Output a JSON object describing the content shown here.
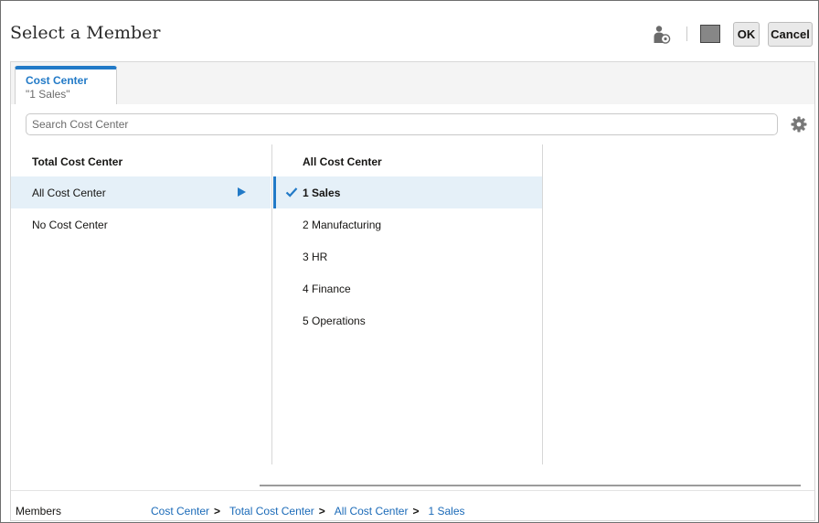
{
  "dialog": {
    "title": "Select a Member",
    "ok_label": "OK",
    "cancel_label": "Cancel"
  },
  "tab": {
    "title": "Cost Center",
    "subtitle": "\"1 Sales\""
  },
  "search": {
    "placeholder": "Search Cost Center"
  },
  "left_column": {
    "header": "Total Cost Center",
    "items": [
      {
        "label": "All Cost Center",
        "selected": true,
        "has_children": true
      },
      {
        "label": "No Cost Center",
        "selected": false,
        "has_children": false
      }
    ]
  },
  "middle_column": {
    "header": "All Cost Center",
    "items": [
      {
        "label": "1 Sales",
        "selected": true
      },
      {
        "label": "2 Manufacturing",
        "selected": false
      },
      {
        "label": "3 HR",
        "selected": false
      },
      {
        "label": "4 Finance",
        "selected": false
      },
      {
        "label": "5 Operations",
        "selected": false
      }
    ]
  },
  "footer": {
    "label": "Members",
    "breadcrumb": [
      "Cost Center",
      "Total Cost Center",
      "All Cost Center",
      "1 Sales"
    ],
    "separator": ">"
  },
  "colors": {
    "accent": "#227ac7",
    "selected_row": "#e5f0f8",
    "link": "#1a6ab8"
  },
  "icons": {
    "member_properties": "user-settings-icon",
    "color_swatch": "swatch-icon",
    "settings": "gear-icon",
    "expand": "triangle-right-icon",
    "check": "checkmark-icon"
  }
}
